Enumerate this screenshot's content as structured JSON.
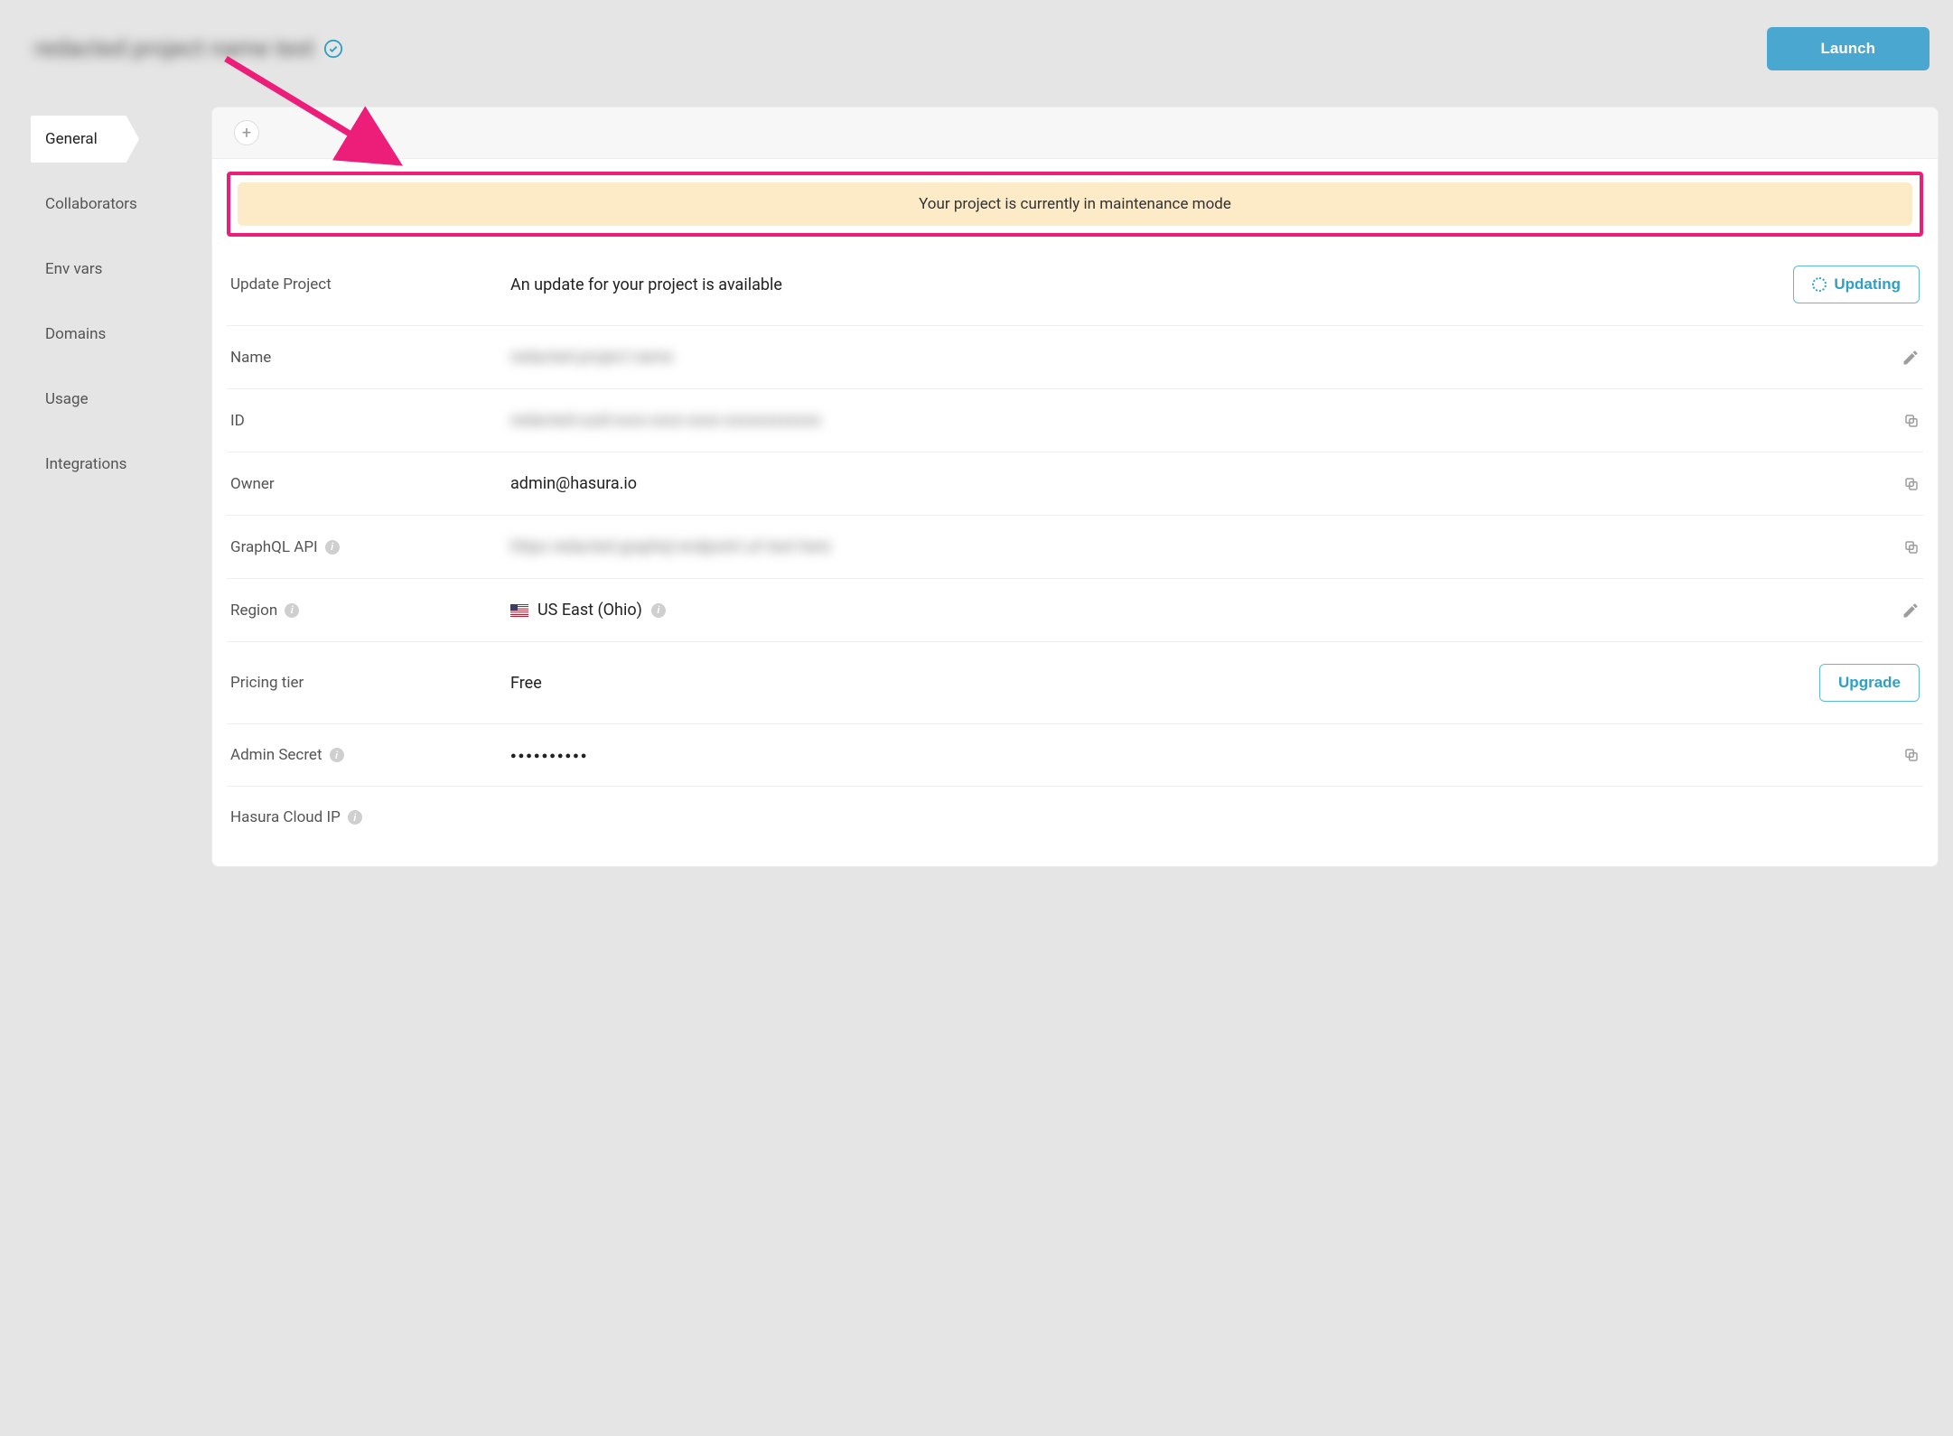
{
  "header": {
    "project_title_blurred": "redacted project name text",
    "launch_label": "Launch"
  },
  "sidebar": {
    "items": [
      {
        "label": "General",
        "active": true
      },
      {
        "label": "Collaborators",
        "active": false
      },
      {
        "label": "Env vars",
        "active": false
      },
      {
        "label": "Domains",
        "active": false
      },
      {
        "label": "Usage",
        "active": false
      },
      {
        "label": "Integrations",
        "active": false
      }
    ]
  },
  "banner": {
    "text": "Your project is currently in maintenance mode"
  },
  "rows": {
    "update_project": {
      "label": "Update Project",
      "value": "An update for your project is available",
      "button": "Updating"
    },
    "name": {
      "label": "Name",
      "value_blurred": "redacted project name"
    },
    "id": {
      "label": "ID",
      "value_blurred": "redacted-uuid-xxxx-xxxx-xxxx-xxxxxxxxxxxx"
    },
    "owner": {
      "label": "Owner",
      "value": "admin@hasura.io"
    },
    "graphql": {
      "label": "GraphQL API",
      "value_blurred": "https redacted graphql endpoint url text here"
    },
    "region": {
      "label": "Region",
      "value": "US East (Ohio)"
    },
    "pricing": {
      "label": "Pricing tier",
      "value": "Free",
      "button": "Upgrade"
    },
    "admin_secret": {
      "label": "Admin Secret",
      "value": "●●●●●●●●●●"
    },
    "cloud_ip": {
      "label": "Hasura Cloud IP"
    }
  },
  "colors": {
    "accent": "#2f9fc4",
    "highlight": "#ec1e79",
    "banner_bg": "#fdebc8"
  }
}
